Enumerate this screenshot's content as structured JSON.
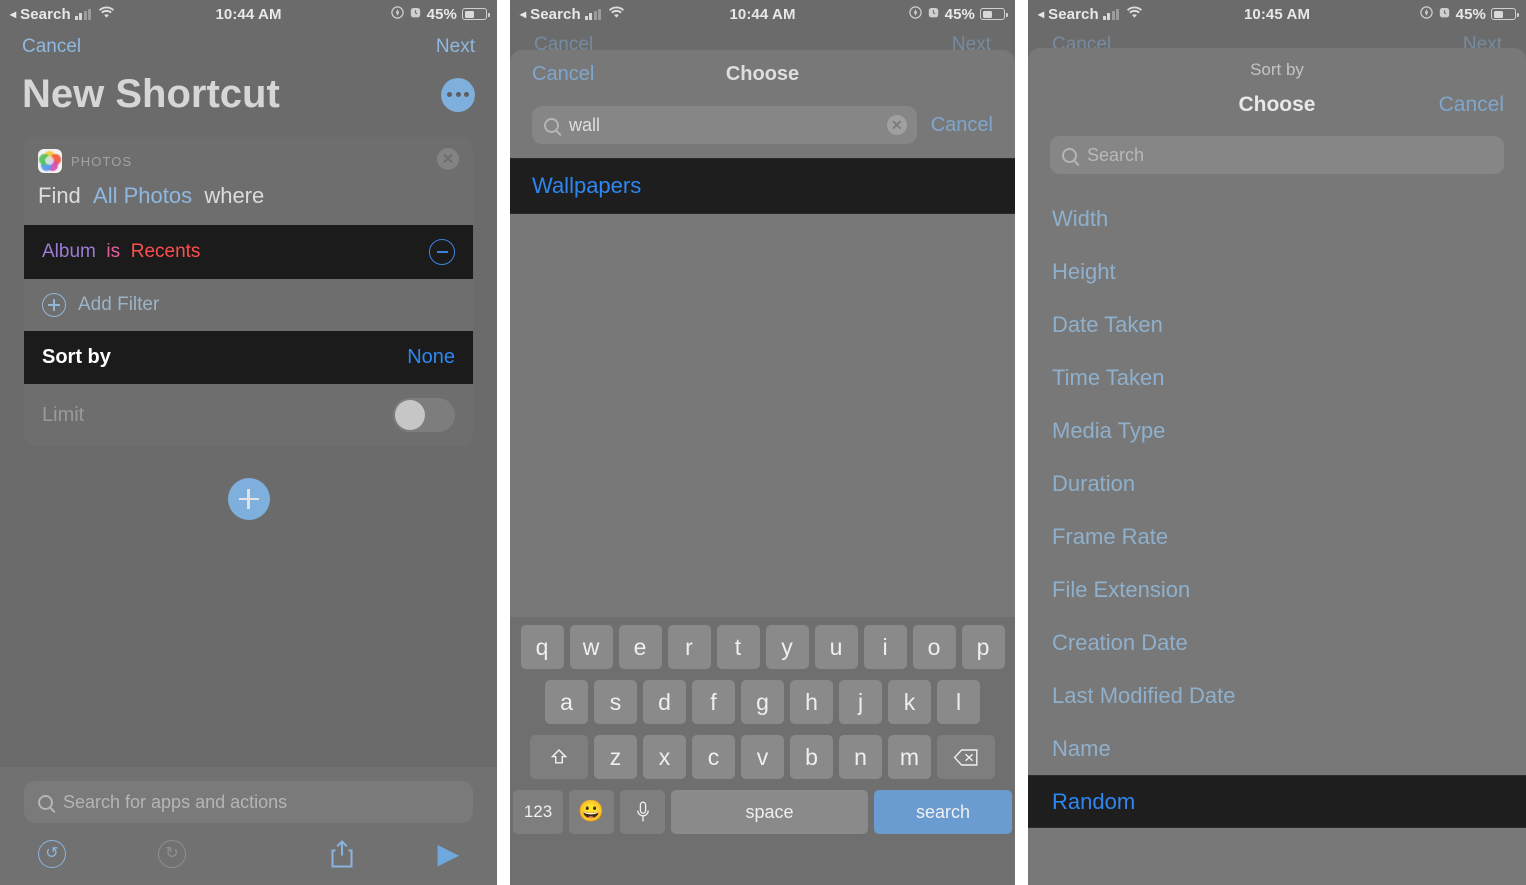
{
  "statusbar": {
    "back_label": "Search",
    "time_left": "10:44 AM",
    "time_mid": "10:44 AM",
    "time_right": "10:45 AM",
    "battery_text": "45%",
    "icons": [
      "back-triangle-icon",
      "cellular-bars-icon",
      "wifi-icon",
      "location-icon",
      "alarm-icon",
      "battery-icon"
    ]
  },
  "panel1": {
    "nav": {
      "cancel": "Cancel",
      "next": "Next"
    },
    "title": "New Shortcut",
    "more_button": "more-options-button",
    "action_card": {
      "app_label": "PHOTOS",
      "remove_icon": "close-circle-icon",
      "sentence_prefix": "Find",
      "sentence_link": "All Photos",
      "sentence_suffix": "where",
      "filter": {
        "field": "Album",
        "operator": "is",
        "value": "Recents",
        "remove_icon": "minus-circle-icon"
      },
      "add_filter_label": "Add Filter",
      "sort_label": "Sort by",
      "sort_value": "None",
      "limit_label": "Limit",
      "limit_enabled": false
    },
    "add_action_button": "add-action-button",
    "search": {
      "placeholder": "Search for apps and actions",
      "value": ""
    },
    "toolbar": [
      "undo-icon",
      "redo-icon",
      "share-icon",
      "play-icon"
    ]
  },
  "panel2": {
    "behind": {
      "cancel": "Cancel",
      "next": "Next"
    },
    "sheet_title": "Choose",
    "sheet_cancel": "Cancel",
    "search": {
      "value": "wall",
      "placeholder": "Search",
      "clear_icon": "clear-circle-icon",
      "cancel": "Cancel"
    },
    "results": [
      "Wallpapers"
    ],
    "keyboard": {
      "row1": [
        "q",
        "w",
        "e",
        "r",
        "t",
        "y",
        "u",
        "i",
        "o",
        "p"
      ],
      "row2": [
        "a",
        "s",
        "d",
        "f",
        "g",
        "h",
        "j",
        "k",
        "l"
      ],
      "row3": [
        "z",
        "x",
        "c",
        "v",
        "b",
        "n",
        "m"
      ],
      "shift": "shift-icon",
      "backspace": "backspace-icon",
      "numbers": "123",
      "emoji": "emoji-icon",
      "mic": "microphone-icon",
      "space": "space",
      "return": "search"
    }
  },
  "panel3": {
    "behind": {
      "cancel": "Cancel",
      "next": "Next"
    },
    "sheet_subtitle": "Sort by",
    "sheet_title": "Choose",
    "sheet_cancel": "Cancel",
    "search": {
      "value": "",
      "placeholder": "Search"
    },
    "options": [
      {
        "label": "Width",
        "selected": false
      },
      {
        "label": "Height",
        "selected": false
      },
      {
        "label": "Date Taken",
        "selected": false
      },
      {
        "label": "Time Taken",
        "selected": false
      },
      {
        "label": "Media Type",
        "selected": false
      },
      {
        "label": "Duration",
        "selected": false
      },
      {
        "label": "Frame Rate",
        "selected": false
      },
      {
        "label": "File Extension",
        "selected": false
      },
      {
        "label": "Creation Date",
        "selected": false
      },
      {
        "label": "Last Modified Date",
        "selected": false
      },
      {
        "label": "Name",
        "selected": false
      },
      {
        "label": "Random",
        "selected": true
      }
    ]
  },
  "colors": {
    "accent_blue": "#2e87f0",
    "muted_blue": "#8fb8e0",
    "dim_backdrop": "#6b6b6b",
    "row_dark": "#1b1b1b",
    "filter_field": "#9b7bd6",
    "filter_operator": "#e05fa0",
    "filter_value": "#ff4d4d",
    "key_return": "#6a9bd1"
  }
}
